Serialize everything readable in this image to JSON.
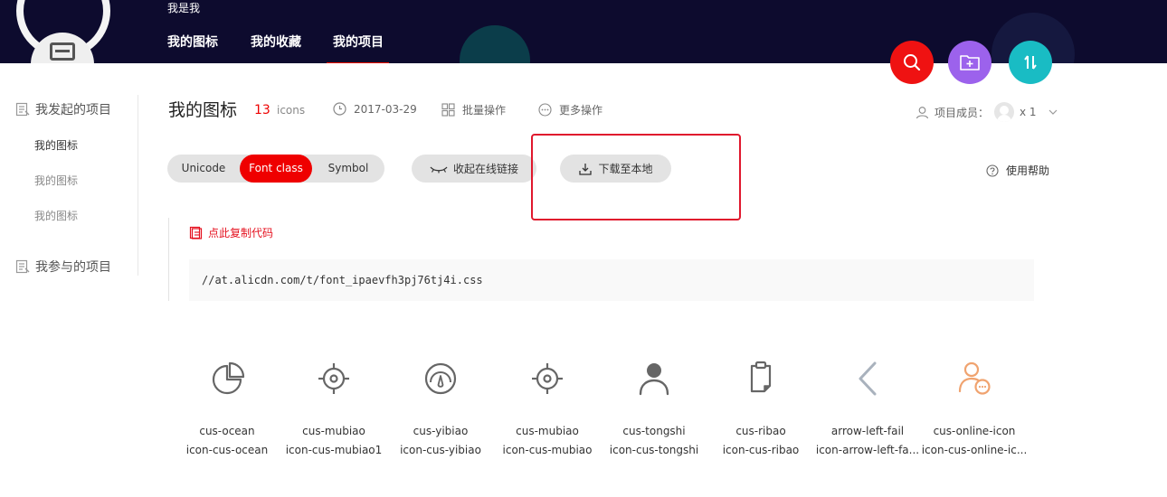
{
  "header": {
    "username": "我是我",
    "tabs": [
      {
        "label": "我的图标"
      },
      {
        "label": "我的收藏"
      },
      {
        "label": "我的项目"
      }
    ]
  },
  "sidebar": {
    "group1": "我发起的项目",
    "items": [
      "我的图标",
      "我的图标",
      "我的图标"
    ],
    "group2": "我参与的项目"
  },
  "project": {
    "title": "我的图标",
    "count": "13",
    "count_unit": "icons",
    "date": "2017-03-29",
    "batch": "批量操作",
    "more": "更多操作",
    "members_label": "项目成员：",
    "members_count": "x 1"
  },
  "toolbar": {
    "tabs": [
      "Unicode",
      "Font class",
      "Symbol"
    ],
    "active_tab": "Font class",
    "collapse_label": "收起在线链接",
    "download_label": "下载至本地",
    "help_label": "使用帮助"
  },
  "code": {
    "copy_label": "点此复制代码",
    "url": "//at.alicdn.com/t/font_ipaevfh3pj76tj4i.css"
  },
  "icons": [
    {
      "name": "cus-ocean",
      "class": "icon-cus-ocean",
      "icon": "pie-chart-icon"
    },
    {
      "name": "cus-mubiao",
      "class": "icon-cus-mubiao1",
      "icon": "target-icon"
    },
    {
      "name": "cus-yibiao",
      "class": "icon-cus-yibiao",
      "icon": "gauge-icon"
    },
    {
      "name": "cus-mubiao",
      "class": "icon-cus-mubiao",
      "icon": "target-icon"
    },
    {
      "name": "cus-tongshi",
      "class": "icon-cus-tongshi",
      "icon": "person-icon"
    },
    {
      "name": "cus-ribao",
      "class": "icon-cus-ribao",
      "icon": "clipboard-icon"
    },
    {
      "name": "arrow-left-fail",
      "class": "icon-arrow-left-fa...",
      "icon": "chevron-left-icon"
    },
    {
      "name": "cus-online-icon",
      "class": "icon-cus-online-ic...",
      "icon": "user-chat-icon"
    }
  ],
  "colors": {
    "header_bg": "#0d0b2e",
    "accent_red": "#ee0000",
    "search_btn": "#ef1212",
    "add_btn": "#9c62ec",
    "sort_btn": "#19bcc4",
    "icon_gray": "#666666",
    "icon_orange": "#f0a36f"
  }
}
